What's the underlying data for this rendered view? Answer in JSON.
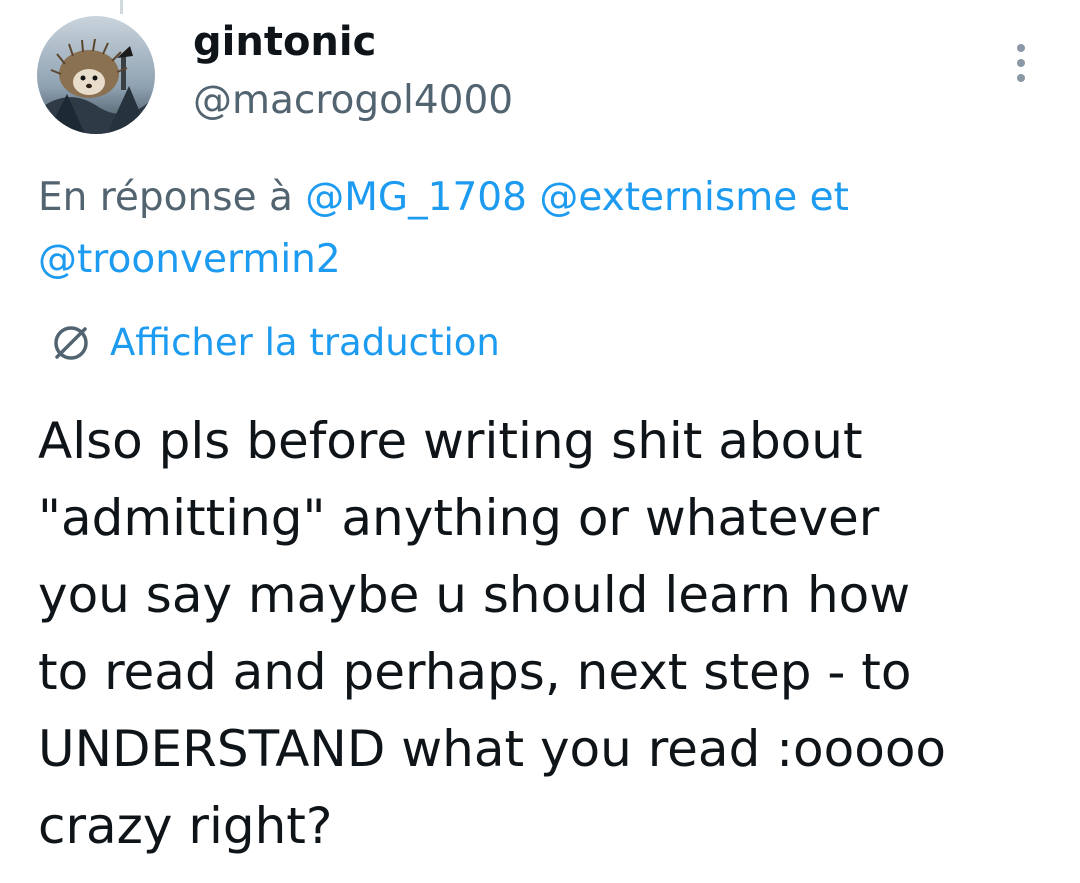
{
  "tweet": {
    "author": {
      "display_name": "gintonic",
      "handle": "@macrogol4000",
      "avatar": "hedgehog-avatar"
    },
    "more_icon": "more-vertical-icon",
    "reply_context": {
      "prefix": "En réponse à",
      "mention_1": "@MG_1708",
      "mention_2": "@externisme",
      "conjunction": "et",
      "mention_3": "@troonvermin2"
    },
    "translate": {
      "icon": "globe-translate-icon",
      "label": "Afficher la traduction"
    },
    "text": "Also pls before writing shit about\n\"admitting\" anything or whatever\nyou say maybe u should learn how\nto read and perhaps, next step - to\nUNDERSTAND what you read :ooooo\ncrazy right?"
  },
  "colors": {
    "text_primary": "#0f1419",
    "text_secondary": "#536471",
    "link": "#1d9bf0",
    "more_dots": "#8b98a5"
  }
}
